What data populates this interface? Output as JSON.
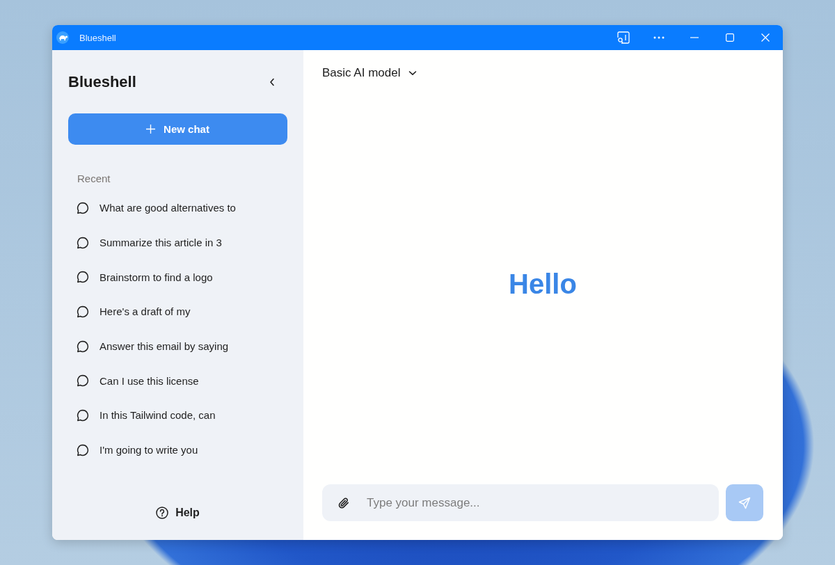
{
  "window": {
    "title": "Blueshell"
  },
  "sidebar": {
    "title": "Blueshell",
    "new_chat": "New chat",
    "section": "Recent",
    "items": [
      {
        "label": "What are good alternatives to",
        "selected": false
      },
      {
        "label": "Summarize this article in 3",
        "selected": false
      },
      {
        "label": "Brainstorm to find a logo",
        "selected": false
      },
      {
        "label": "Here's a draft of my",
        "selected": false
      },
      {
        "label": "Answer this email by saying",
        "selected": false
      },
      {
        "label": "Can I use this license",
        "selected": false
      },
      {
        "label": "In this Tailwind code, can",
        "selected": false
      },
      {
        "label": "I'm going to write you",
        "selected": false
      }
    ],
    "help": "Help"
  },
  "main": {
    "model": "Basic AI model",
    "greeting": "Hello",
    "composer": {
      "placeholder": "Type your message..."
    },
    "send_button": {
      "disabled": true
    }
  }
}
